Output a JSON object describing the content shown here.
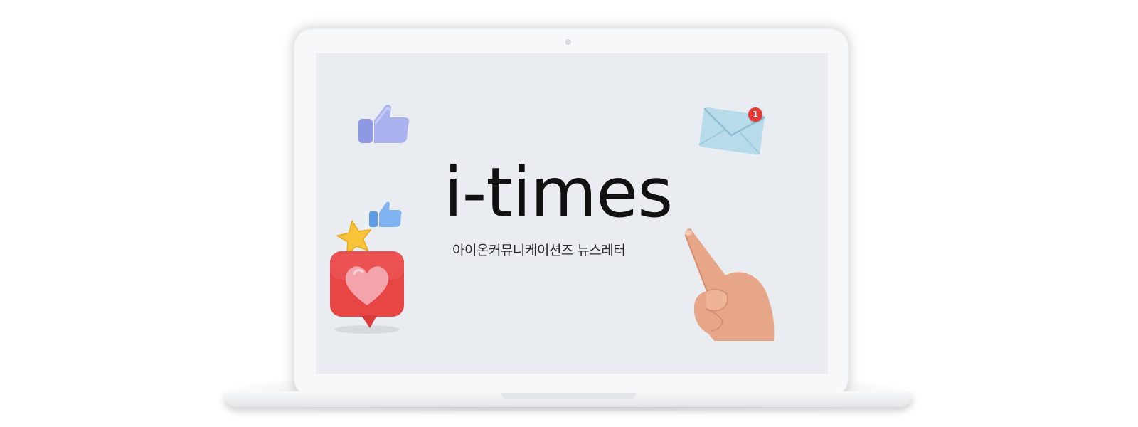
{
  "newsletter": {
    "brand_title": "i-times",
    "subtitle": "아이온커뮤니케이션즈 뉴스레터"
  },
  "notification": {
    "unread_count": "1"
  },
  "colors": {
    "screen_bg": "#e9ecf0",
    "laptop_body": "#f7f8f9",
    "badge_red": "#e53935",
    "envelope": "#a9d4e6",
    "thumb_purple": "#a9b2ef",
    "thumb_blue": "#7fb2f0",
    "heart_box_red": "#e84545",
    "heart_pink": "#f4a3aa",
    "star_yellow": "#f8c43a",
    "hand_skin": "#e7a688"
  },
  "icons": [
    "thumbs-up-icon",
    "envelope-icon",
    "star-icon",
    "heart-icon",
    "pointing-hand-icon"
  ]
}
